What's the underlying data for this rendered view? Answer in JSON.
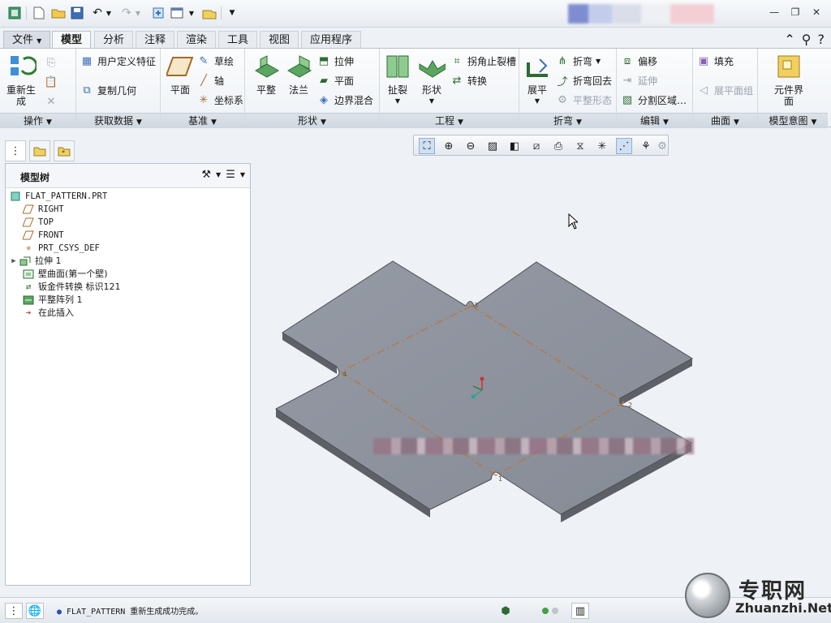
{
  "tabs": [
    "文件",
    "模型",
    "分析",
    "注释",
    "渲染",
    "工具",
    "视图",
    "应用程序"
  ],
  "ribbon": {
    "operations": {
      "regenerate": "重新生成",
      "footer": "操作"
    },
    "get_data": {
      "udf": "用户定义特征",
      "copy_geom": "复制几何",
      "footer": "获取数据"
    },
    "datum": {
      "plane": "平面",
      "sketch": "草绘",
      "axis": "轴",
      "csys": "坐标系",
      "footer": "基准"
    },
    "shapes": {
      "flat": "平整",
      "flange": "法兰",
      "extrude": "拉伸",
      "planar": "平面",
      "boundary_blend": "边界混合",
      "footer": "形状"
    },
    "engineering": {
      "rip": "扯裂",
      "form": "形状",
      "corner_relief": "拐角止裂槽",
      "convert": "转换",
      "footer": "工程"
    },
    "bends": {
      "unbend": "展平",
      "bend": "折弯",
      "bend_back": "折弯回去",
      "flatten_form": "平整形态",
      "footer": "折弯"
    },
    "editing": {
      "offset": "偏移",
      "extend": "延伸",
      "split_area": "分割区域…",
      "footer": "编辑"
    },
    "surfaces": {
      "fill": "填充",
      "flat_quilt": "展平面组",
      "footer": "曲面"
    },
    "model_intent": {
      "component_interface": "元件界面",
      "footer": "模型意图"
    }
  },
  "panel": {
    "title": "模型树",
    "items": [
      {
        "label": "FLAT_PATTERN.PRT",
        "icon": "part-icon"
      },
      {
        "label": "RIGHT",
        "icon": "datum-plane-icon"
      },
      {
        "label": "TOP",
        "icon": "datum-plane-icon"
      },
      {
        "label": "FRONT",
        "icon": "datum-plane-icon"
      },
      {
        "label": "PRT_CSYS_DEF",
        "icon": "csys-icon"
      },
      {
        "label": "拉伸 1",
        "icon": "extrude-icon"
      },
      {
        "label": "壁曲面(第一个壁)",
        "icon": "wall-icon"
      },
      {
        "label": "钣金件转换 标识121",
        "icon": "convert-icon"
      },
      {
        "label": "平整阵列 1",
        "icon": "flat-pattern-icon"
      },
      {
        "label": "在此插入",
        "icon": "insert-arrow-icon"
      }
    ]
  },
  "viewport": {
    "labels": [
      "4",
      "3",
      "2",
      "1"
    ]
  },
  "status": {
    "message": "FLAT_PATTERN 重新生成成功完成。"
  },
  "watermark": {
    "cn": "专职网",
    "en": "Zhuanzhi.Net"
  },
  "colors": {
    "part_face": "#8e939e",
    "part_edge": "#55585f",
    "bend_line": "#b8763a",
    "ribbon_bg": "#f6f8fb"
  }
}
